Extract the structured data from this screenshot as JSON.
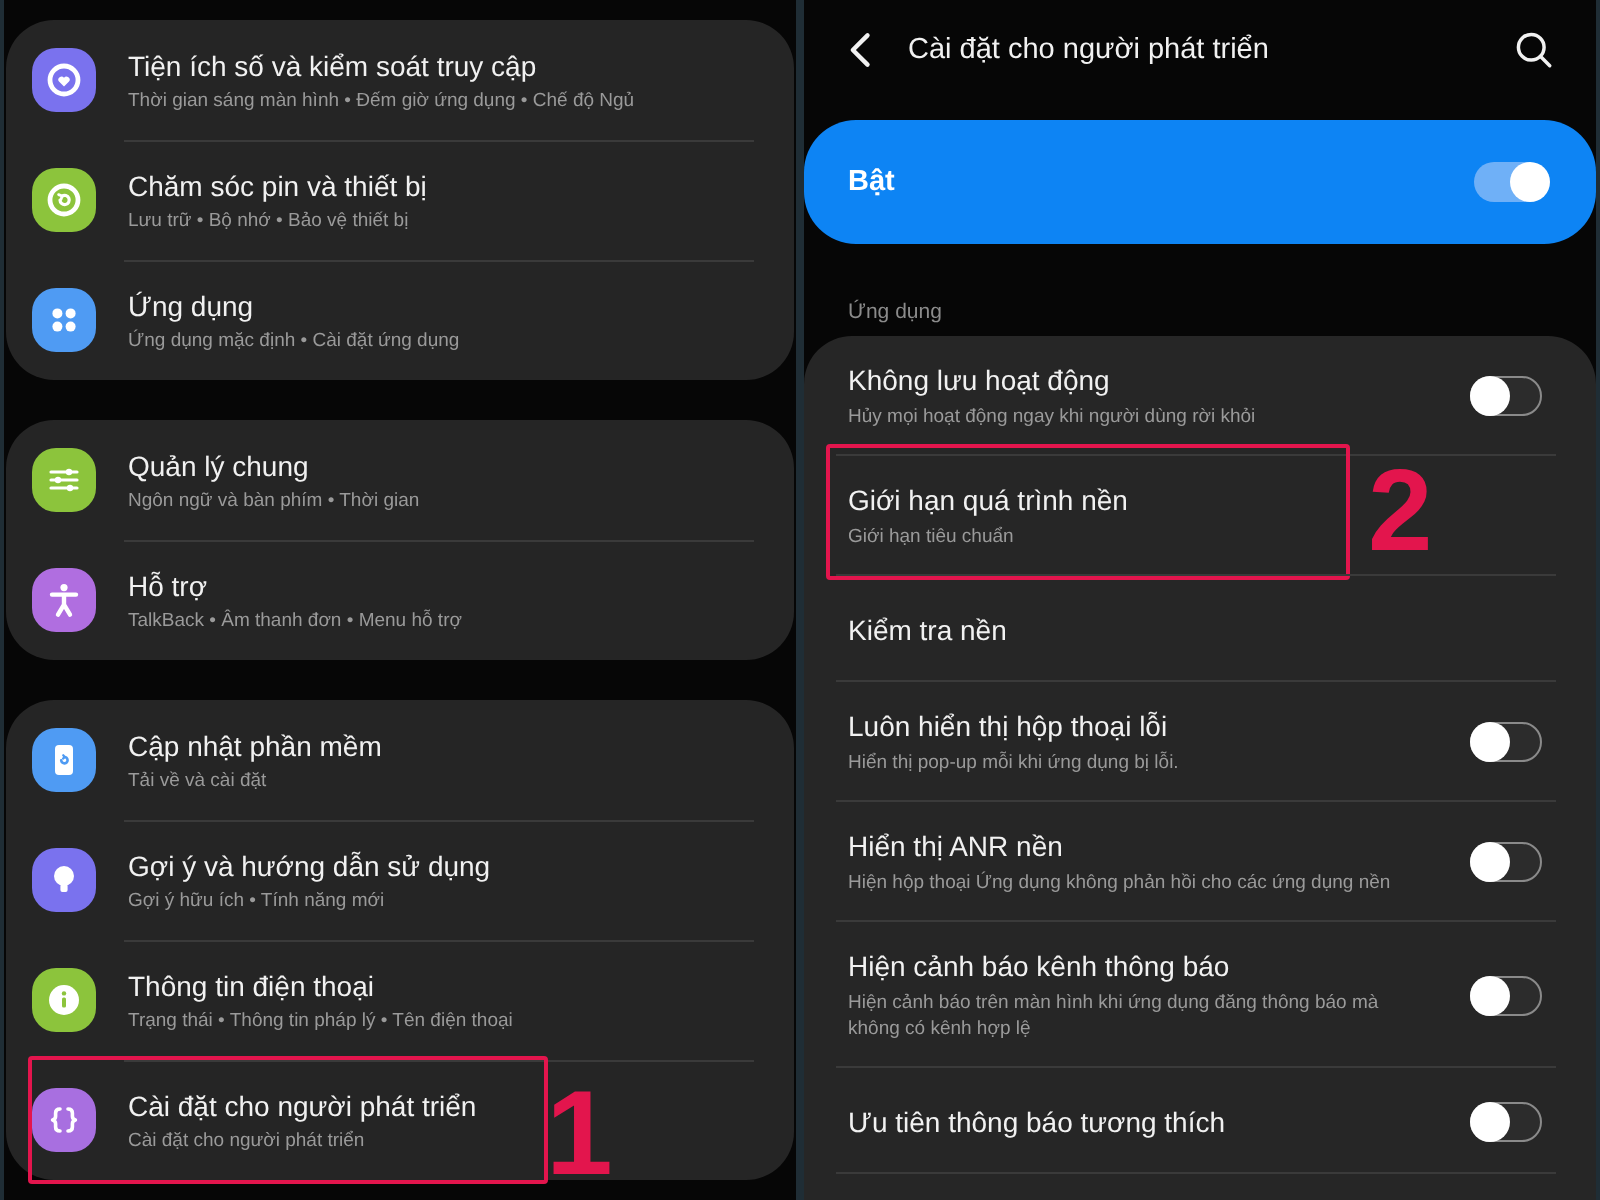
{
  "left_screen": {
    "groups": [
      {
        "items": [
          {
            "title": "Tiện ích số và kiểm soát truy cập",
            "subtitle": "Thời gian sáng màn hình • Đếm giờ ứng dụng • Chế độ Ngủ",
            "color": "#7a72ee"
          },
          {
            "title": "Chăm sóc pin và thiết bị",
            "subtitle": "Lưu trữ • Bộ nhớ • Bảo vệ thiết bị",
            "color": "#8cc43c"
          },
          {
            "title": "Ứng dụng",
            "subtitle": "Ứng dụng mặc định • Cài đặt ứng dụng",
            "color": "#4f9bf3"
          }
        ]
      },
      {
        "items": [
          {
            "title": "Quản lý chung",
            "subtitle": "Ngôn ngữ và bàn phím • Thời gian",
            "color": "#8cc43c"
          },
          {
            "title": "Hỗ trợ",
            "subtitle": "TalkBack • Âm thanh đơn • Menu hỗ trợ",
            "color": "#b06ee0"
          }
        ]
      },
      {
        "items": [
          {
            "title": "Cập nhật phần mềm",
            "subtitle": "Tải về và cài đặt",
            "color": "#4f9bf3"
          },
          {
            "title": "Gợi ý và hướng dẫn sử dụng",
            "subtitle": "Gợi ý hữu ích • Tính năng mới",
            "color": "#7a72ee"
          },
          {
            "title": "Thông tin điện thoại",
            "subtitle": "Trạng thái • Thông tin pháp lý • Tên điện thoại",
            "color": "#8cc43c"
          },
          {
            "title": "Cài đặt cho người phát triển",
            "subtitle": "Cài đặt cho người phát triển",
            "color": "#a86fe0",
            "callout": "1"
          }
        ]
      }
    ]
  },
  "right_screen": {
    "header": {
      "title": "Cài đặt cho người phát triển"
    },
    "master_switch": {
      "label": "Bật",
      "on": true
    },
    "section": {
      "label": "Ứng dụng"
    },
    "settings": [
      {
        "kind": "switch",
        "title": "Không lưu hoạt động",
        "subtitle": "Hủy mọi hoạt động ngay khi người dùng rời khỏi",
        "on": false
      },
      {
        "kind": "link",
        "title": "Giới hạn quá trình nền",
        "subtitle": "Giới hạn tiêu chuẩn",
        "callout": "2"
      },
      {
        "kind": "link",
        "title": "Kiểm tra nền"
      },
      {
        "kind": "switch",
        "title": "Luôn hiển thị hộp thoại lỗi",
        "subtitle": "Hiển thị pop-up mỗi khi ứng dụng bị lỗi.",
        "on": false
      },
      {
        "kind": "switch",
        "title": "Hiển thị ANR nền",
        "subtitle": "Hiện hộp thoại Ứng dụng không phản hồi cho các ứng dụng nền",
        "on": false
      },
      {
        "kind": "switch",
        "title": "Hiện cảnh báo kênh thông báo",
        "subtitle": "Hiện cảnh báo trên màn hình khi ứng dụng đăng thông báo mà không có kênh hợp lệ",
        "on": false
      },
      {
        "kind": "switch",
        "title": "Ưu tiên thông báo tương thích",
        "on": false
      }
    ]
  }
}
